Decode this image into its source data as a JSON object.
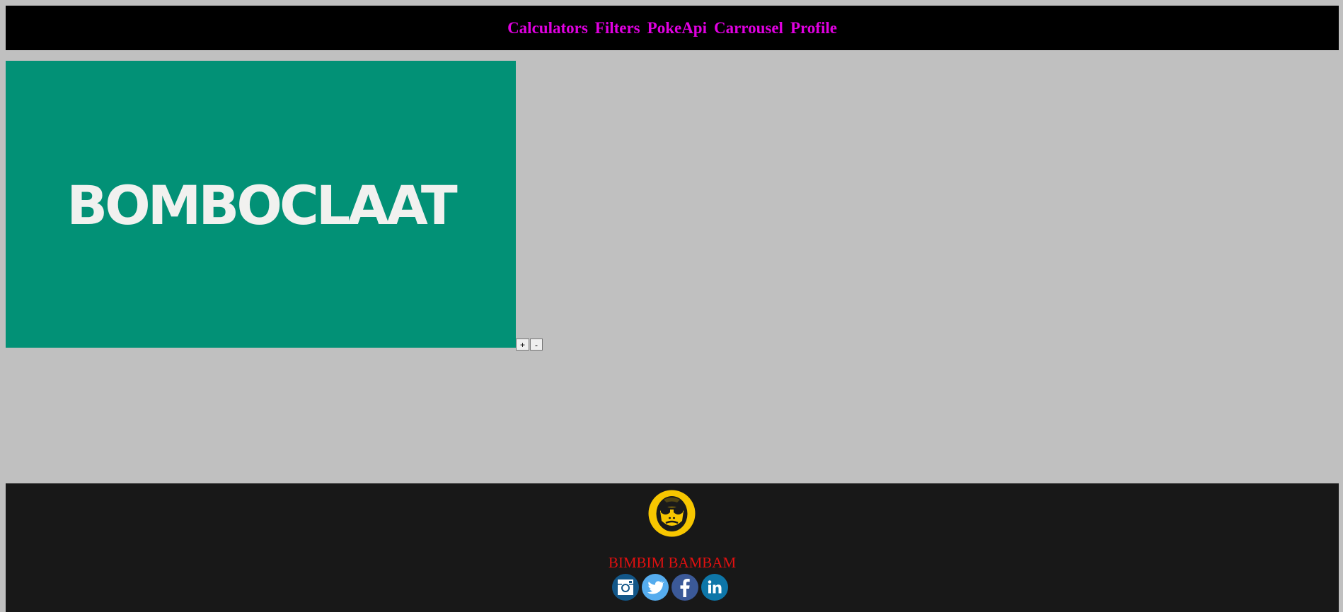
{
  "nav": {
    "links": [
      {
        "label": "Calculators"
      },
      {
        "label": "Filters"
      },
      {
        "label": "PokeApi"
      },
      {
        "label": "Carrousel"
      },
      {
        "label": "Profile"
      }
    ]
  },
  "banner": {
    "text": "BOMBOCLAAT"
  },
  "zoom": {
    "in_label": "+",
    "out_label": "-"
  },
  "footer": {
    "logo_icon": "monkey-sunglasses-logo-icon",
    "name": "BIMBIM BAMBAM",
    "socials": [
      {
        "icon": "instagram-icon",
        "color": "#125688"
      },
      {
        "icon": "twitter-icon",
        "color": "#55acee"
      },
      {
        "icon": "facebook-icon",
        "color": "#3b5998"
      },
      {
        "icon": "linkedin-icon",
        "color": "#0e76a8"
      }
    ]
  },
  "colors": {
    "page_background": "#c0c0c0",
    "navbar_background": "#000000",
    "nav_link": "#e000e0",
    "banner_background": "#029176",
    "footer_background": "#181818",
    "footer_name": "#e01010",
    "logo_yellow": "#f7c600"
  }
}
